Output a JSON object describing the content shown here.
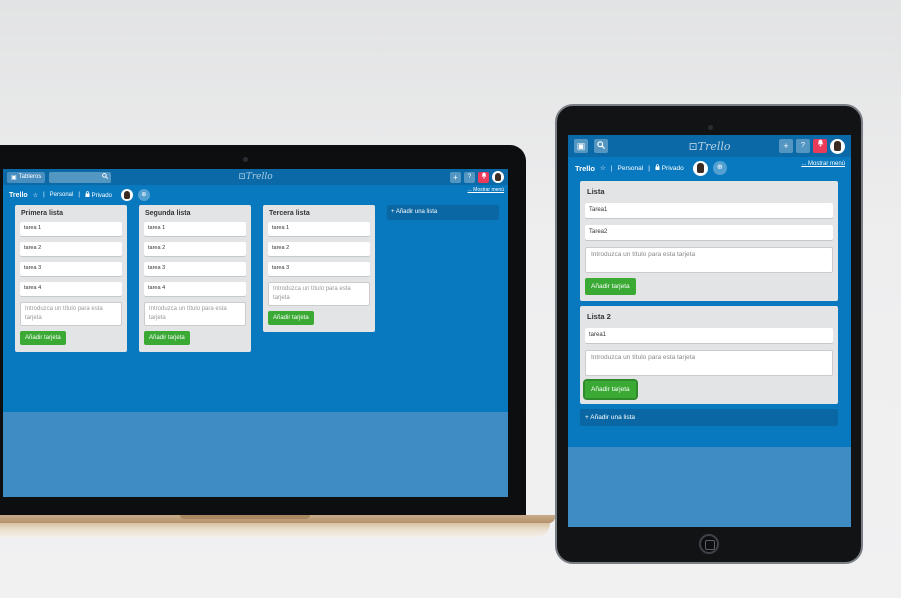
{
  "app": {
    "logo": "Trello",
    "board_name": "Trello",
    "star": "☆",
    "team": "Personal",
    "visibility": "Privado",
    "show_menu": "... Mostrar menú",
    "boards_button": "Tableros"
  },
  "laptop": {
    "lists": [
      {
        "title": "Primera lista",
        "cards": [
          "tarea 1",
          "tarea 2",
          "tarea 3",
          "tarea 4"
        ],
        "placeholder": "Introduzca un título para esta tarjeta",
        "add_button": "Añadir tarjeta"
      },
      {
        "title": "Segunda lista",
        "cards": [
          "tarea 1",
          "tarea 2",
          "tarea 3",
          "tarea 4"
        ],
        "placeholder": "Introduzca un título para esta tarjeta",
        "add_button": "Añadir tarjeta"
      },
      {
        "title": "Tercera lista",
        "cards": [
          "tarea 1",
          "tarea 2",
          "tarea 3"
        ],
        "placeholder": "Introduzca un título para esta tarjeta",
        "add_button": "Añadir tarjeta"
      }
    ],
    "add_list": "+ Añadir una lista"
  },
  "tablet": {
    "lists": [
      {
        "title": "Lista",
        "cards": [
          "Tarea1",
          "Tarea2"
        ],
        "placeholder": "Introduzca un título para esta tarjeta",
        "add_button": "Añadir tarjeta"
      },
      {
        "title": "Lista 2",
        "cards": [
          "tarea1"
        ],
        "placeholder": "Introduzca un título para esta tarjeta",
        "add_button": "Añadir tarjeta"
      }
    ],
    "add_list": "+ Añadir una lista"
  },
  "icons": {
    "board": "▣",
    "search": "⚲",
    "plus": "+",
    "info": "?",
    "bell": "🔔",
    "lock": "🔒",
    "invite": "+"
  }
}
